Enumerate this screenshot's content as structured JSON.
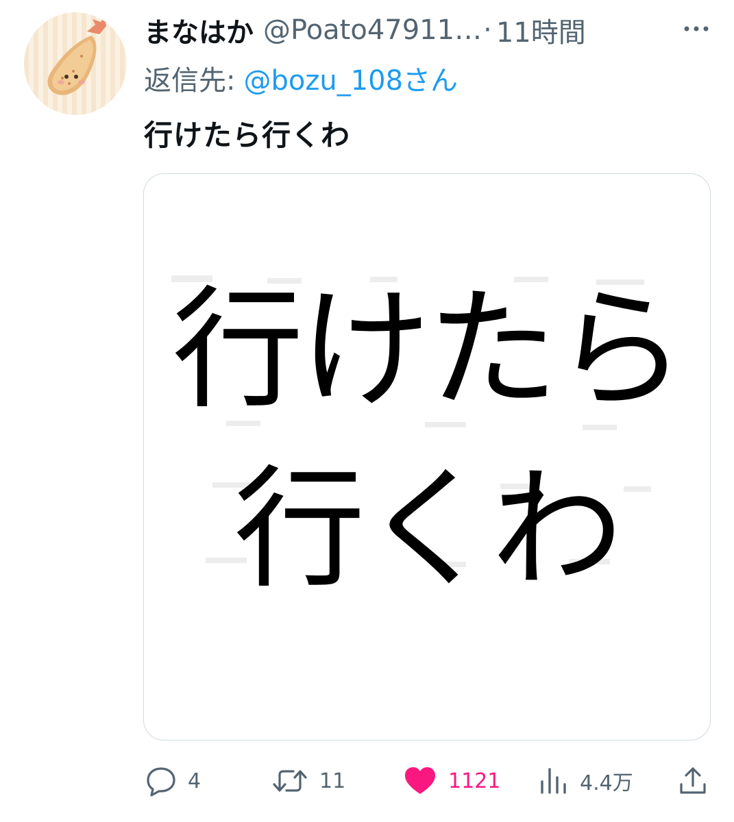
{
  "tweet": {
    "author": {
      "display_name": "まなはか",
      "handle": "@Poato47911…",
      "separator": "·",
      "time": "11時間"
    },
    "reply": {
      "prefix": "返信先:",
      "target": "@bozu_108さん"
    },
    "text": "行けたら行くわ",
    "media": {
      "line1": "行けたら",
      "line2": "行くわ"
    },
    "actions": {
      "replies": "4",
      "retweets": "11",
      "likes": "1121",
      "views": "4.4万"
    }
  },
  "colors": {
    "text_primary": "#0f1419",
    "text_secondary": "#536471",
    "link": "#1d9bf0",
    "like": "#f91880",
    "border": "#cfd9de"
  },
  "icons": {
    "avatar": "fried-shrimp-avatar",
    "more": "more-dots-icon",
    "reply": "reply-bubble-icon",
    "retweet": "retweet-icon",
    "like": "heart-filled-icon",
    "views": "views-bar-chart-icon",
    "share": "share-upload-icon"
  }
}
